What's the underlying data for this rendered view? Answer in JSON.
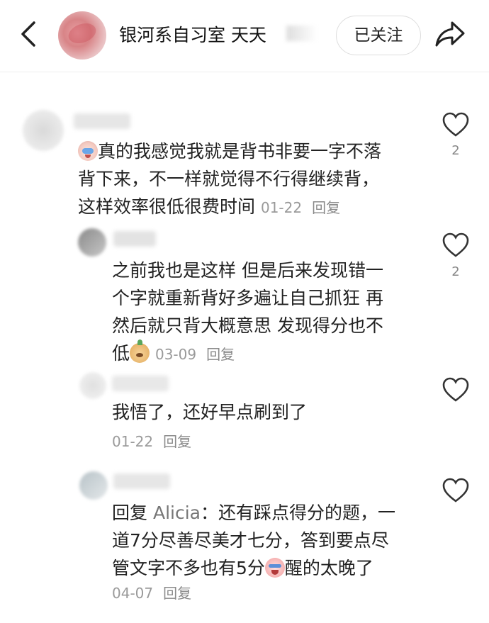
{
  "header": {
    "title": "银河系自习室 天天",
    "follow_label": "已关注"
  },
  "comments": [
    {
      "lines": [
        "真的我感觉我就是背书非要一字不落",
        "背下来，不一样就觉得不行得继续背，",
        "这样效率很低很费时间"
      ],
      "date": "01-22",
      "reply": "回复",
      "likes": "2",
      "emoji": "crying-face"
    },
    {
      "lines": [
        "之前我也是这样 但是后来发现错一",
        "个字就重新背好多遍让自己抓狂 再",
        "然后就只背大概意思 发现得分也不",
        "低"
      ],
      "date": "03-09",
      "reply": "回复",
      "likes": "2",
      "emoji": "doge-face"
    },
    {
      "lines": [
        "我悟了，还好早点刷到了"
      ],
      "date": "01-22",
      "reply": "回复"
    },
    {
      "reply_prefix": "回复",
      "reply_to": "Alicia",
      "lines": [
        "：还有踩点得分的题，一",
        "道7分尽善尽美才七分，答到要点尽",
        "管文字不多也有5分",
        "醒的太晚了"
      ],
      "date": "04-07",
      "reply": "回复",
      "emoji": "sob-face"
    }
  ],
  "icons": {
    "back": "chevron-left-icon",
    "share": "share-arrow-icon",
    "like": "heart-outline-icon"
  },
  "colors": {
    "text": "#222222",
    "meta": "#9a9a9a",
    "border": "#dddddd"
  }
}
